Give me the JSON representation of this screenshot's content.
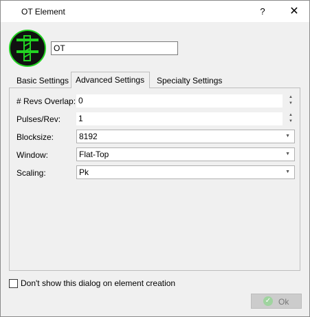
{
  "window": {
    "title": "OT Element",
    "help_label": "?",
    "close_label": "✕"
  },
  "element": {
    "name_value": "OT"
  },
  "tabs": [
    {
      "label": "Basic Settings"
    },
    {
      "label": "Advanced Settings"
    },
    {
      "label": "Specialty Settings"
    }
  ],
  "active_tab": "Advanced Settings",
  "fields": {
    "revs_overlap": {
      "label": "# Revs Overlap:",
      "value": "0"
    },
    "pulses_rev": {
      "label": "Pulses/Rev:",
      "value": "1"
    },
    "blocksize": {
      "label": "Blocksize:",
      "value": "8192"
    },
    "window": {
      "label": "Window:",
      "value": "Flat-Top"
    },
    "scaling": {
      "label": "Scaling:",
      "value": "Pk"
    }
  },
  "footer": {
    "checkbox_label": "Don't show this dialog on element creation",
    "ok_label": "Ok"
  },
  "colors": {
    "logo_bg": "#111111",
    "logo_accent": "#22d322",
    "ok_icon": "#9fd49f"
  },
  "icons": {
    "logo": "ot-element-logo",
    "spinner": "spin-arrows",
    "dropdown": "chevron-down-icon",
    "ok": "check-circle-icon"
  }
}
